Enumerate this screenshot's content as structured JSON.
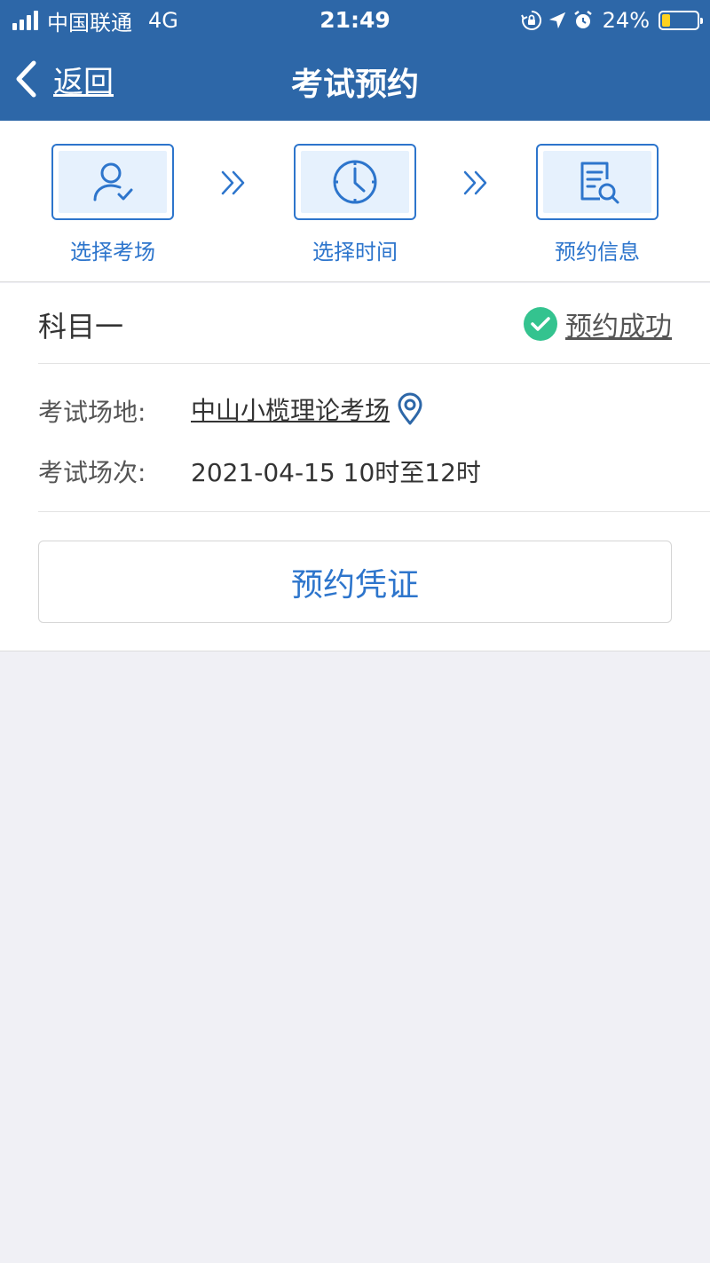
{
  "status_bar": {
    "carrier": "中国联通",
    "network": "4G",
    "time": "21:49",
    "battery_percent": "24%",
    "battery_level": 0.24,
    "battery_color": "#ffd21f"
  },
  "nav": {
    "back_label": "返回",
    "title": "考试预约"
  },
  "steps": [
    {
      "label": "选择考场",
      "icon": "user-check-icon"
    },
    {
      "label": "选择时间",
      "icon": "clock-icon"
    },
    {
      "label": "预约信息",
      "icon": "document-search-icon"
    }
  ],
  "booking": {
    "subject": "科目一",
    "status": "预约成功",
    "venue_label": "考试场地:",
    "venue": "中山小榄理论考场",
    "session_label": "考试场次:",
    "session": "2021-04-15 10时至12时",
    "voucher_button": "预约凭证"
  },
  "colors": {
    "header": "#2d67a8",
    "accent": "#2d75cc",
    "success": "#34c38f",
    "background": "#f0f0f5"
  }
}
